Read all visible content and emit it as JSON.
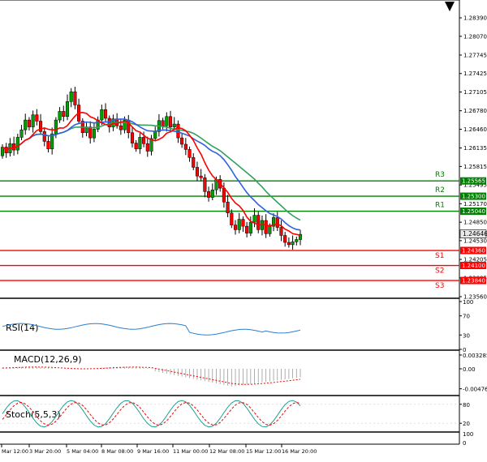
{
  "main": {
    "price_ticks": [
      "1.28390",
      "1.28070",
      "1.27745",
      "1.27425",
      "1.27105",
      "1.26780",
      "1.26460",
      "1.26135",
      "1.25815",
      "1.25495",
      "1.25170",
      "1.24850",
      "1.24530",
      "1.24205",
      "1.23885",
      "1.23560"
    ],
    "current_price": "1.24646",
    "levels": [
      {
        "label": "R3",
        "price": "1.25565",
        "color": "#008000"
      },
      {
        "label": "R2",
        "price": "1.25300",
        "color": "#008000"
      },
      {
        "label": "R1",
        "price": "1.25040",
        "color": "#008000"
      },
      {
        "label": "S1",
        "price": "1.24360",
        "color": "#ff0000"
      },
      {
        "label": "S2",
        "price": "1.24100",
        "color": "#ff0000"
      },
      {
        "label": "S3",
        "price": "1.23840",
        "color": "#ff0000"
      }
    ],
    "colors": {
      "bull": "#00a000",
      "bear": "#ff0000",
      "ma_fast": "#ff0000",
      "ma_mid": "#3060e0",
      "ma_slow": "#33a060"
    }
  },
  "rsi": {
    "label": "RSI(14)",
    "ticks": [
      "100",
      "70",
      "30",
      "0"
    ],
    "color": "#2a7fd0"
  },
  "macd": {
    "label": "MACD(12,26,9)",
    "ticks": [
      "0.003285",
      "0.00",
      "-0.004769"
    ],
    "signal_color": "#ff0000"
  },
  "stoch": {
    "label": "Stoch(5,5,3)",
    "ticks": [
      "80",
      "20"
    ],
    "main_color": "#20a090",
    "signal_color": "#ff0000"
  },
  "bottom_ticks": [
    "100",
    "0"
  ],
  "time_axis": [
    "Mar 12:00",
    "3 Mar 20:00",
    "5 Mar 04:00",
    "8 Mar 08:00",
    "9 Mar 16:00",
    "11 Mar 00:00",
    "12 Mar 08:00",
    "15 Mar 12:00",
    "16 Mar 20:00"
  ]
}
